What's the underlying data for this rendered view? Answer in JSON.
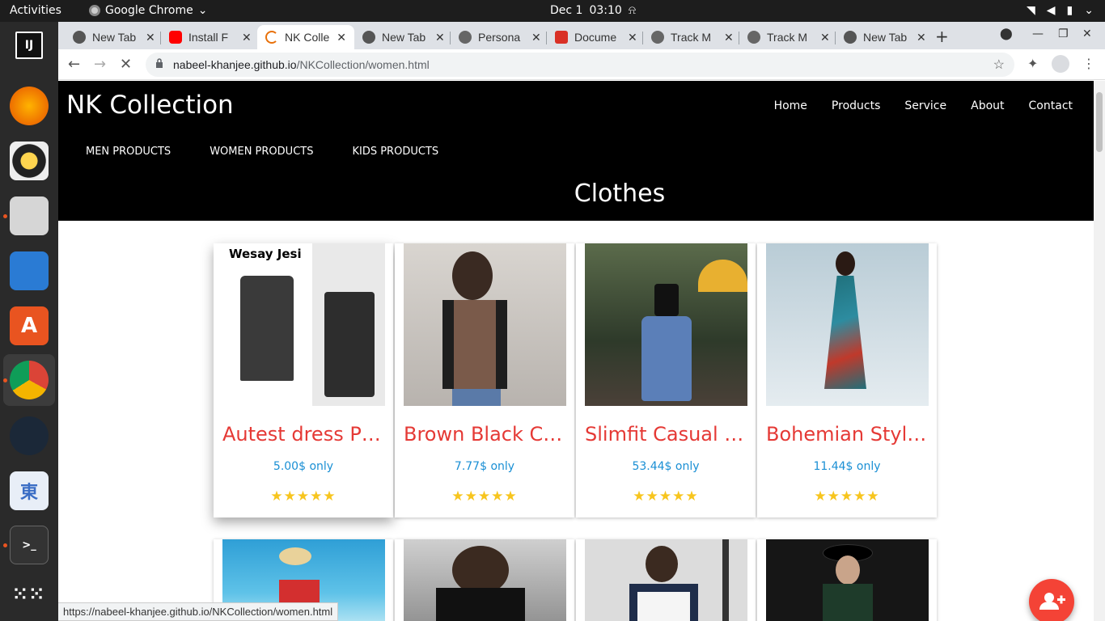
{
  "system": {
    "activities": "Activities",
    "app_name": "Google Chrome",
    "date": "Dec 1",
    "time": "03:10"
  },
  "browser": {
    "tabs": [
      {
        "label": "New Tab",
        "favicon": "chrome-icon"
      },
      {
        "label": "Install F",
        "favicon": "youtube-icon"
      },
      {
        "label": "NK Colle",
        "favicon": "loading-icon",
        "active": true
      },
      {
        "label": "New Tab",
        "favicon": "chrome-icon"
      },
      {
        "label": "Persona",
        "favicon": "globe-icon"
      },
      {
        "label": "Docume",
        "favicon": "docs-icon"
      },
      {
        "label": "Track M",
        "favicon": "globe-icon"
      },
      {
        "label": "Track M",
        "favicon": "globe-icon"
      },
      {
        "label": "New Tab",
        "favicon": "chrome-icon"
      }
    ],
    "url_host": "nabeel-khanjee.github.io",
    "url_path": "/NKCollection/women.html",
    "status_url": "https://nabeel-khanjee.github.io/NKCollection/women.html"
  },
  "site": {
    "brand": "NK Collection",
    "nav": [
      "Home",
      "Products",
      "Service",
      "About",
      "Contact"
    ],
    "subnav": [
      "MEN PRODUCTS",
      "WOMEN PRODUCTS",
      "KIDS PRODUCTS"
    ],
    "heading": "Clothes",
    "products": [
      {
        "name": "Autest dress Pl...",
        "price": "5.00$ only",
        "rating": "★★★★★"
      },
      {
        "name": "Brown Black Ca...",
        "price": "7.77$ only",
        "rating": "★★★★★"
      },
      {
        "name": "Slimfit Casual D...",
        "price": "53.44$ only",
        "rating": "★★★★★"
      },
      {
        "name": "Bohemian Style...",
        "price": "11.44$ only",
        "rating": "★★★★★"
      }
    ],
    "photo_label": "Wesay Jesi"
  },
  "colors": {
    "header_bg": "#000000",
    "product_name": "#e53935",
    "price": "#1a8fd4",
    "star": "#f7c51e",
    "fab": "#f44336"
  }
}
